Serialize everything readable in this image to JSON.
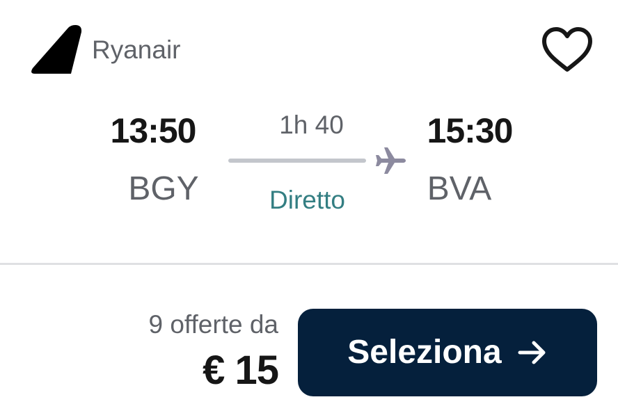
{
  "airline": {
    "name": "Ryanair",
    "logo_icon": "tail-fin-icon"
  },
  "favorite": {
    "icon": "heart-icon"
  },
  "flight": {
    "departure_time": "13:50",
    "departure_code": "BGY",
    "arrival_time": "15:30",
    "arrival_code": "BVA",
    "duration": "1h 40",
    "stops": "Diretto"
  },
  "pricing": {
    "offers_label": "9 offerte da",
    "price": "€ 15"
  },
  "action": {
    "select_label": "Seleziona",
    "arrow_icon": "arrow-right-icon"
  },
  "colors": {
    "button_bg": "#05203c",
    "direct_text": "#337e82",
    "secondary_text": "#5f6268",
    "plane_icon": "#8c8a9f"
  }
}
